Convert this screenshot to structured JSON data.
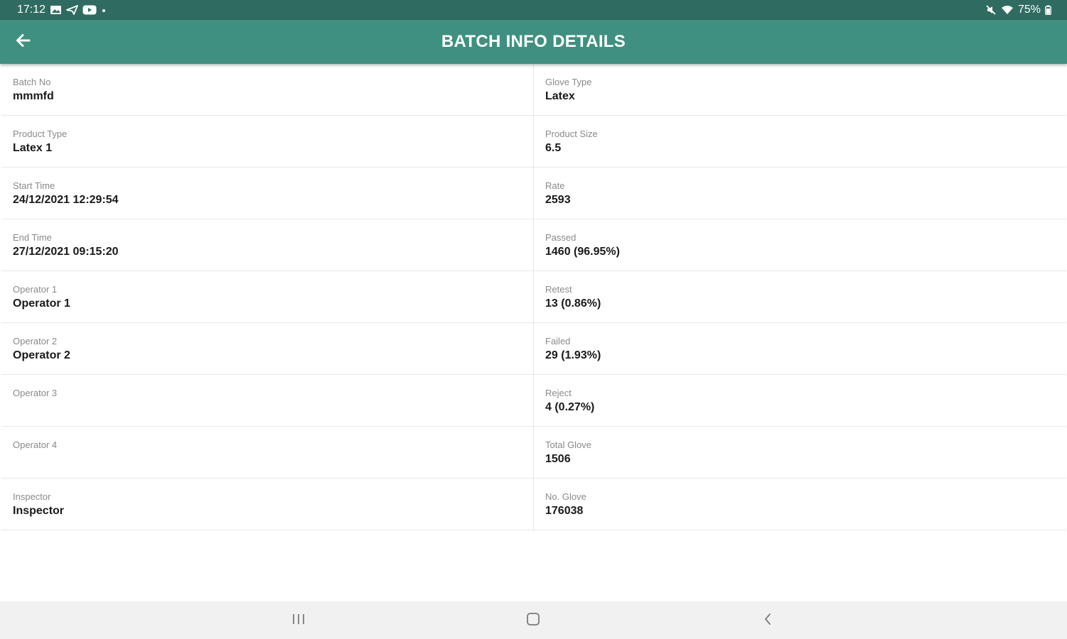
{
  "status_bar": {
    "time": "17:12",
    "battery": "75%"
  },
  "app_bar": {
    "title": "BATCH INFO DETAILS",
    "back_icon": "arrow-back-icon"
  },
  "fields": [
    {
      "label": "Batch No",
      "value": "mmmfd"
    },
    {
      "label": "Glove Type",
      "value": "Latex"
    },
    {
      "label": "Product Type",
      "value": "Latex 1"
    },
    {
      "label": "Product Size",
      "value": "6.5"
    },
    {
      "label": "Start Time",
      "value": "24/12/2021 12:29:54"
    },
    {
      "label": "Rate",
      "value": "2593"
    },
    {
      "label": "End Time",
      "value": "27/12/2021 09:15:20"
    },
    {
      "label": "Passed",
      "value": "1460  (96.95%)"
    },
    {
      "label": "Operator 1",
      "value": "Operator 1"
    },
    {
      "label": "Retest",
      "value": "13  (0.86%)"
    },
    {
      "label": "Operator 2",
      "value": "Operator 2"
    },
    {
      "label": "Failed",
      "value": "29  (1.93%)"
    },
    {
      "label": "Operator 3",
      "value": ""
    },
    {
      "label": "Reject",
      "value": "4  (0.27%)"
    },
    {
      "label": "Operator 4",
      "value": ""
    },
    {
      "label": "Total Glove",
      "value": "1506"
    },
    {
      "label": "Inspector",
      "value": "Inspector"
    },
    {
      "label": "No. Glove",
      "value": "176038"
    }
  ],
  "nav_bar": {
    "recents_icon": "recents-icon",
    "home_icon": "home-icon",
    "back_icon": "nav-back-icon"
  },
  "colors": {
    "status_bar": "#2f6b61",
    "app_bar": "#3f9080",
    "nav_bar": "#f1f1f1"
  }
}
